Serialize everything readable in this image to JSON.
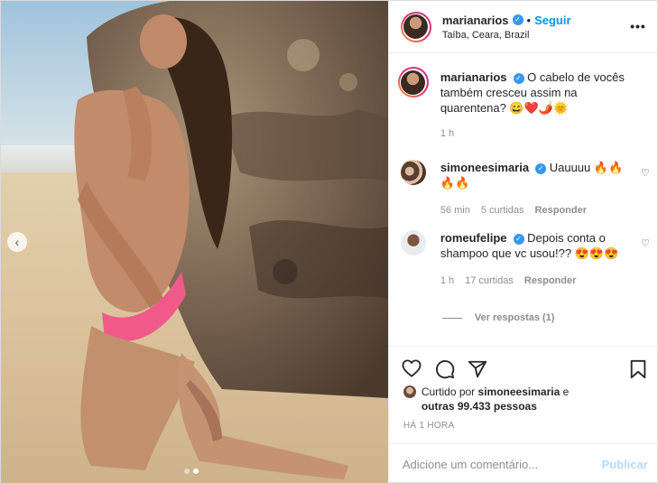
{
  "post": {
    "author": "marianarios",
    "follow_label": "Seguir",
    "separator": "•",
    "location": "Taíba, Ceara, Brazil",
    "more_icon": "more-horizontal-icon"
  },
  "caption": {
    "username": "marianarios",
    "text": "O cabelo de vocês também cresceu assim na quarentena? 😄❤️🌶️🌞",
    "time": "1 h"
  },
  "comments": [
    {
      "username": "simoneesimaria",
      "text": "Uauuuu 🔥🔥🔥🔥",
      "time": "56 min",
      "likes": "5 curtidas",
      "reply_label": "Responder"
    },
    {
      "username": "romeufelipe",
      "text": "Depois conta o shampoo que vc usou!?? 😍😍😍",
      "time": "1 h",
      "likes": "17 curtidas",
      "reply_label": "Responder"
    }
  ],
  "view_replies": "Ver respostas (1)",
  "liked_by": {
    "prefix": "Curtido por",
    "user": "simoneesimaria",
    "connector": "e",
    "others": "outras 99.433 pessoas"
  },
  "timestamp": "HÁ 1 HORA",
  "comment_box": {
    "placeholder": "Adicione um comentário...",
    "publish_label": "Publicar"
  },
  "carousel": {
    "current": 2,
    "total": 2
  },
  "colors": {
    "link_blue": "#0095f6",
    "verified_blue": "#3897f0",
    "muted_gray": "#8e8e8e",
    "publish_disabled": "#b3dbff"
  }
}
